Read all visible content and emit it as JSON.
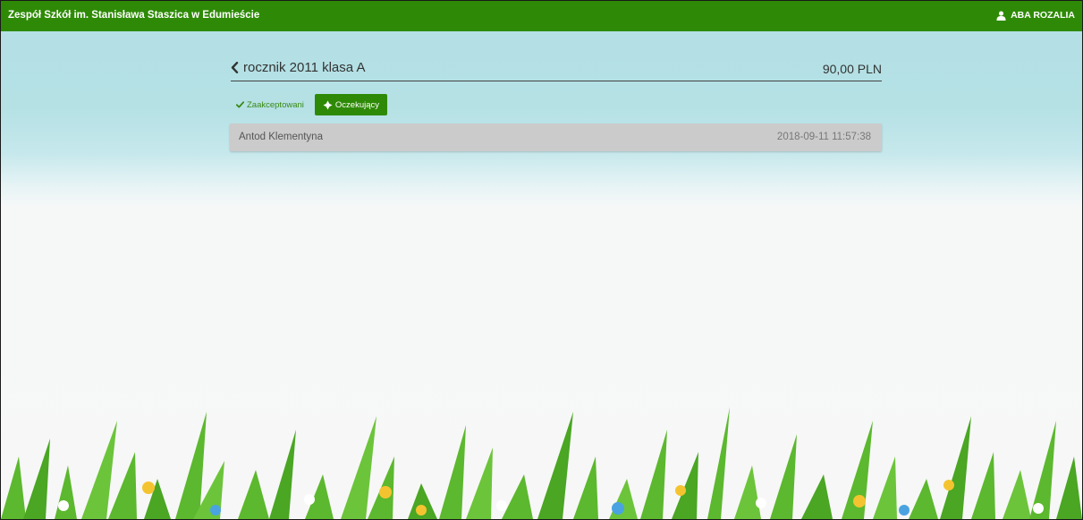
{
  "header": {
    "school_name": "Zespół Szkół im. Stanisława Staszica w Edumieście",
    "user_name": "ABA ROZALIA",
    "user_icon": "user-icon",
    "bar_color": "#2e8a06"
  },
  "main": {
    "back_icon": "chevron-left-icon",
    "group_title": "rocznik 2011 klasa A",
    "amount": "90,00 PLN",
    "tabs": [
      {
        "label": "Zaakceptowani",
        "icon": "check-icon",
        "active": false
      },
      {
        "label": "Oczekujący",
        "icon": "hourglass-icon",
        "active": true
      }
    ],
    "rows": [
      {
        "name": "Antod Klementyna",
        "datetime": "2018-09-11 11:57:38"
      }
    ]
  },
  "decoration": {
    "background_top": "#b3e0e5",
    "background_bottom": "#f7f7f7",
    "grass_color": "#5cb82e"
  }
}
